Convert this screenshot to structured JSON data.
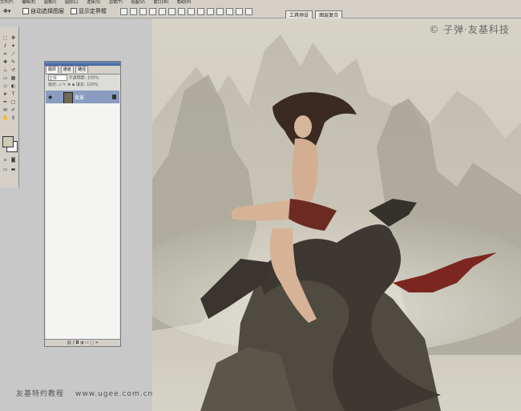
{
  "menu": [
    "文件(F)",
    "编辑(E)",
    "图像(I)",
    "图层(L)",
    "选择(S)",
    "滤镜(T)",
    "视图(V)",
    "窗口(W)",
    "帮助(H)"
  ],
  "options": {
    "auto_select": "自动选择图层",
    "show_bounds": "显示定界框"
  },
  "well_tabs": [
    "工具预设",
    "图层复合"
  ],
  "layers_panel": {
    "tabs": [
      "图层",
      "通道",
      "路径"
    ],
    "blend_mode": "正常",
    "opacity_label": "不透明度:",
    "opacity_value": "100%",
    "lock_label": "锁定:",
    "fill_label": "填充:",
    "fill_value": "100%",
    "layer_name": "背景"
  },
  "canvas": {
    "copyright": "© 子弹·友基科技"
  },
  "watermark": {
    "text": "友基特约教程",
    "url": "www.ugee.com.cn"
  },
  "colors": {
    "foreground": "#cfccb4",
    "background": "#ffffff",
    "selected_layer": "#8a9cc0"
  }
}
